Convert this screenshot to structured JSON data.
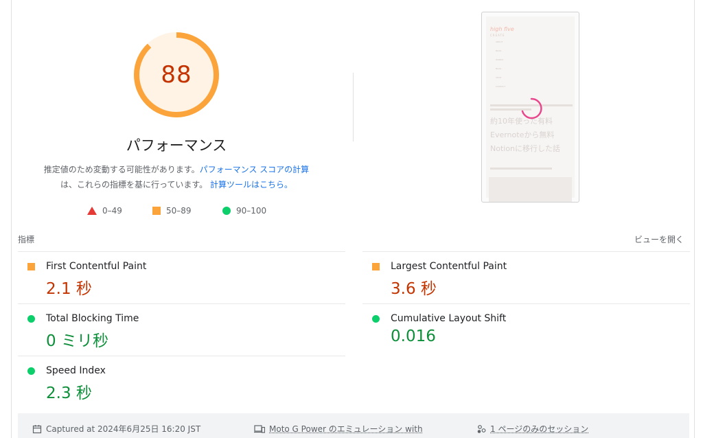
{
  "score": {
    "value": 88,
    "fraction": 0.88,
    "color": "#fba43b"
  },
  "category": {
    "title": "パフォーマンス",
    "desc_text": "推定値のため変動する可能性があります。",
    "desc_link1": "パフォーマンス スコアの計算",
    "desc_text2": "は、これらの指標を基に行っています。",
    "desc_link2": "計算ツールはこちら。"
  },
  "legend": [
    {
      "label": "0–49",
      "shape": "triangle",
      "color": "#e53935"
    },
    {
      "label": "50–89",
      "shape": "square",
      "color": "#fba43b"
    },
    {
      "label": "90–100",
      "shape": "circle",
      "color": "#0cce6b"
    }
  ],
  "thumbnail": {
    "logo_line1": "high five",
    "logo_line2": "CREATE",
    "nav": [
      "ABOUT",
      "BLOG",
      "WORKS",
      "BLOG",
      "SHOP",
      "CONTACT"
    ],
    "headline": [
      "約10年使った有料",
      "Evernoteから無料",
      "Notionに移行した話"
    ]
  },
  "metrics_section": {
    "label": "指標",
    "expand": "ビューを開く"
  },
  "metrics": [
    {
      "title": "First Contentful Paint",
      "value": "2.1 秒",
      "status": "average"
    },
    {
      "title": "Largest Contentful Paint",
      "value": "3.6 秒",
      "status": "average"
    },
    {
      "title": "Total Blocking Time",
      "value": "0 ミリ秒",
      "status": "pass"
    },
    {
      "title": "Cumulative Layout Shift",
      "value": "0.016",
      "status": "pass"
    },
    {
      "title": "Speed Index",
      "value": "2.3 秒",
      "status": "pass"
    }
  ],
  "footer": {
    "captured": "Captured at 2024年6月25日 16:20 JST",
    "device": "Moto G Power のエミュレーション with",
    "session": "1 ページのみのセッション"
  }
}
